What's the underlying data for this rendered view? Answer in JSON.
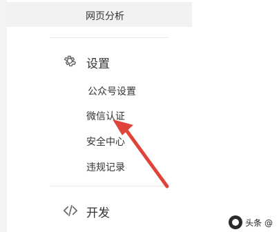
{
  "menu": {
    "analytics": {
      "active_item_label": "网页分析"
    },
    "settings": {
      "title": "设置",
      "icon": "gear-icon",
      "items": [
        {
          "label": "公众号设置"
        },
        {
          "label": "微信认证"
        },
        {
          "label": "安全中心"
        },
        {
          "label": "违规记录"
        }
      ]
    },
    "develop": {
      "title": "开发",
      "icon": "code-icon"
    }
  },
  "annotation": {
    "arrow_color": "#e0433a",
    "target": "微信认证"
  },
  "watermark": {
    "text": "头条 @"
  }
}
